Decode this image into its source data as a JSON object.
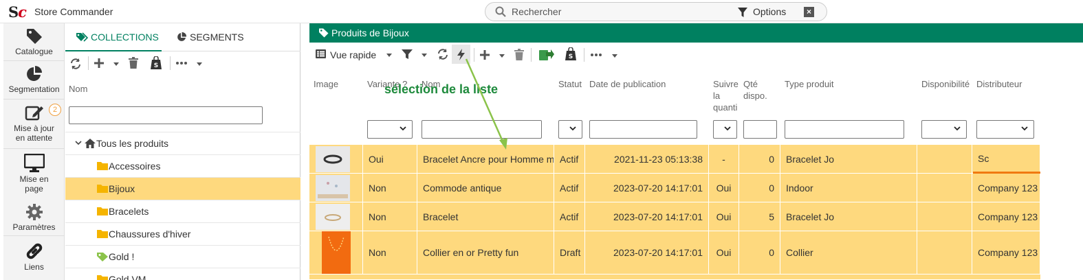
{
  "app": {
    "title": "Store Commander",
    "logo_s": "S",
    "logo_c": "c"
  },
  "search": {
    "placeholder": "Rechercher",
    "options_label": "Options"
  },
  "nav": [
    {
      "label": "Catalogue",
      "icon": "tag-icon"
    },
    {
      "label": "Segmentation",
      "icon": "pie-chart-icon"
    },
    {
      "label_1": "Mise à jour",
      "label_2": "en attente",
      "badge": "2",
      "icon": "edit-icon"
    },
    {
      "label_1": "Mise en",
      "label_2": "page",
      "icon": "monitor-icon"
    },
    {
      "label": "Paramètres",
      "icon": "gear-icon"
    },
    {
      "label": "Liens",
      "icon": "link-icon"
    }
  ],
  "tree": {
    "tabs": [
      {
        "label": "COLLECTIONS",
        "active": true
      },
      {
        "label": "SEGMENTS",
        "active": false
      }
    ],
    "column_header": "Nom",
    "items": [
      {
        "label": "Tous les produits",
        "type": "root"
      },
      {
        "label": "Accessoires",
        "type": "folder"
      },
      {
        "label": "Bijoux",
        "type": "folder",
        "selected": true
      },
      {
        "label": "Bracelets",
        "type": "folder"
      },
      {
        "label": "Chaussures d'hiver",
        "type": "folder"
      },
      {
        "label": "Gold !",
        "type": "smart-tag"
      },
      {
        "label": "Gold VM",
        "type": "folder"
      }
    ]
  },
  "main": {
    "header_title": "Produits de Bijoux",
    "toolbar": {
      "view_label": "Vue rapide"
    },
    "annotation": "sélection de la liste",
    "columns": {
      "image": "Image",
      "variante": "Variante ?",
      "nom": "Nom",
      "statut": "Statut",
      "date": "Date de publication",
      "suivre_1": "Suivre",
      "suivre_2": "la",
      "suivre_3": "quanti",
      "qte_1": "Qté",
      "qte_2": "dispo.",
      "type": "Type produit",
      "dispo": "Disponibilité",
      "distributeur": "Distributeur"
    },
    "rows": [
      {
        "variante": "Oui",
        "nom": "Bracelet Ancre pour Homme m",
        "statut": "Actif",
        "date": "2021-11-23 05:13:38",
        "suivre": "-",
        "qte": "0",
        "type": "Bracelet Jo",
        "dispo": "",
        "distributeur": "Sc",
        "thumb_color": "#e8e8e8"
      },
      {
        "variante": "Non",
        "nom": "Commode antique",
        "statut": "Actif",
        "date": "2023-07-20 14:17:01",
        "suivre": "Oui",
        "qte": "0",
        "type": "Indoor",
        "dispo": "",
        "distributeur": "Company 123",
        "thumb_color": "#e4e6ea"
      },
      {
        "variante": "Non",
        "nom": "Bracelet",
        "statut": "Actif",
        "date": "2023-07-20 14:17:01",
        "suivre": "Oui",
        "qte": "5",
        "type": "Bracelet Jo",
        "dispo": "",
        "distributeur": "Company 123",
        "thumb_color": "#eeeeee"
      },
      {
        "variante": "Non",
        "nom": "Collier en or Pretty fun",
        "statut": "Draft",
        "date": "2023-07-20 14:17:01",
        "suivre": "Oui",
        "qte": "0",
        "type": "Collier",
        "dispo": "",
        "distributeur": "Company 123",
        "thumb_color": "#f26b10"
      }
    ]
  },
  "colors": {
    "accent": "#008060",
    "row_bg": "#fed97e",
    "annotation": "#1e8a3c",
    "brand_red": "#d0021b"
  }
}
